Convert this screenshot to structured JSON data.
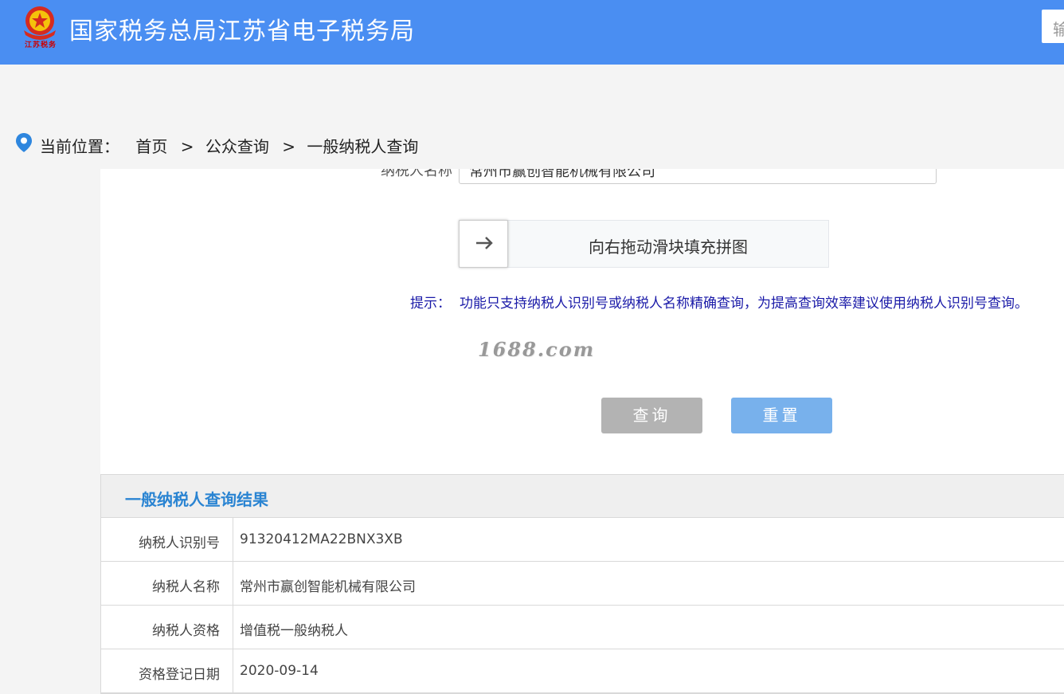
{
  "header": {
    "site_title": "国家税务总局江苏省电子税务局",
    "logo_caption": "江苏税务",
    "search_placeholder": "输"
  },
  "breadcrumb": {
    "lead": "当前位置：",
    "items": [
      "首页",
      "公众查询",
      "一般纳税人查询"
    ],
    "separator": ">"
  },
  "form": {
    "name_label": "纳税人名称",
    "name_value": "常州市赢创智能机械有限公司",
    "slider_text": "向右拖动滑块填充拼图",
    "hint_label": "提示：",
    "hint_text": "功能只支持纳税人识别号或纳税人名称精确查询，为提高查询效率建议使用纳税人识别号查询。",
    "watermark": "1688.com",
    "query_label": "查询",
    "reset_label": "重置"
  },
  "result": {
    "title": "一般纳税人查询结果",
    "rows": [
      {
        "label": "纳税人识别号",
        "value": "91320412MA22BNX3XB"
      },
      {
        "label": "纳税人名称",
        "value": "常州市赢创智能机械有限公司"
      },
      {
        "label": "纳税人资格",
        "value": "增值税一般纳税人"
      },
      {
        "label": "资格登记日期",
        "value": "2020-09-14"
      }
    ]
  },
  "colors": {
    "header_bg": "#4a8ef2",
    "hint_text": "#1a1aa8",
    "result_title": "#2a84d2",
    "query_button": "#b3b3b3",
    "reset_button": "#78b1ec"
  },
  "icons": [
    "tax-emblem-icon",
    "location-pin-icon",
    "arrow-right-icon"
  ]
}
